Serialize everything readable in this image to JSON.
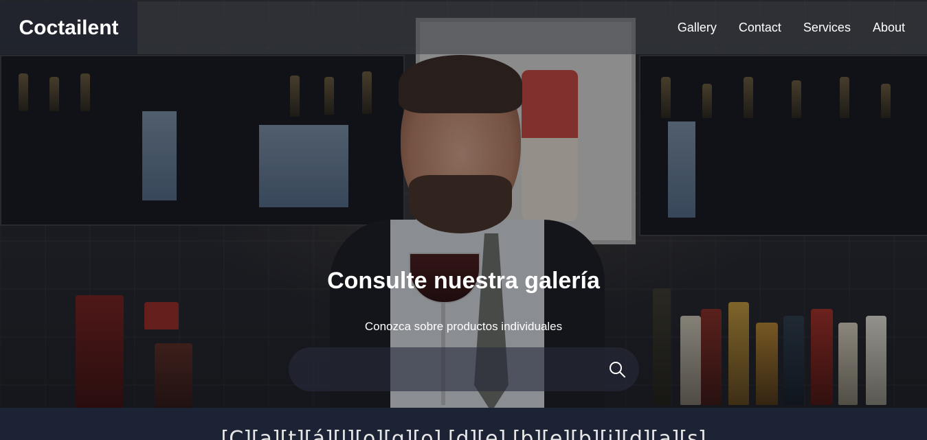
{
  "brand": {
    "name": "Coctailent"
  },
  "nav": {
    "items": [
      {
        "label": "Gallery"
      },
      {
        "label": "Contact"
      },
      {
        "label": "Services"
      },
      {
        "label": "About"
      }
    ]
  },
  "hero": {
    "title": "Consulte nuestra galería",
    "subtitle": "Conozca sobre productos individuales",
    "search": {
      "value": "",
      "icon": "search-icon"
    }
  },
  "section": {
    "title": "[C][a][t][á][l][o][g][o] [d][e] [b][e][b][i][d][a][s]"
  },
  "colors": {
    "navbar_bg": "#3c3e44",
    "brand_bg": "#1e222c",
    "band_bg": "#1b2335",
    "text": "#ffffff"
  }
}
